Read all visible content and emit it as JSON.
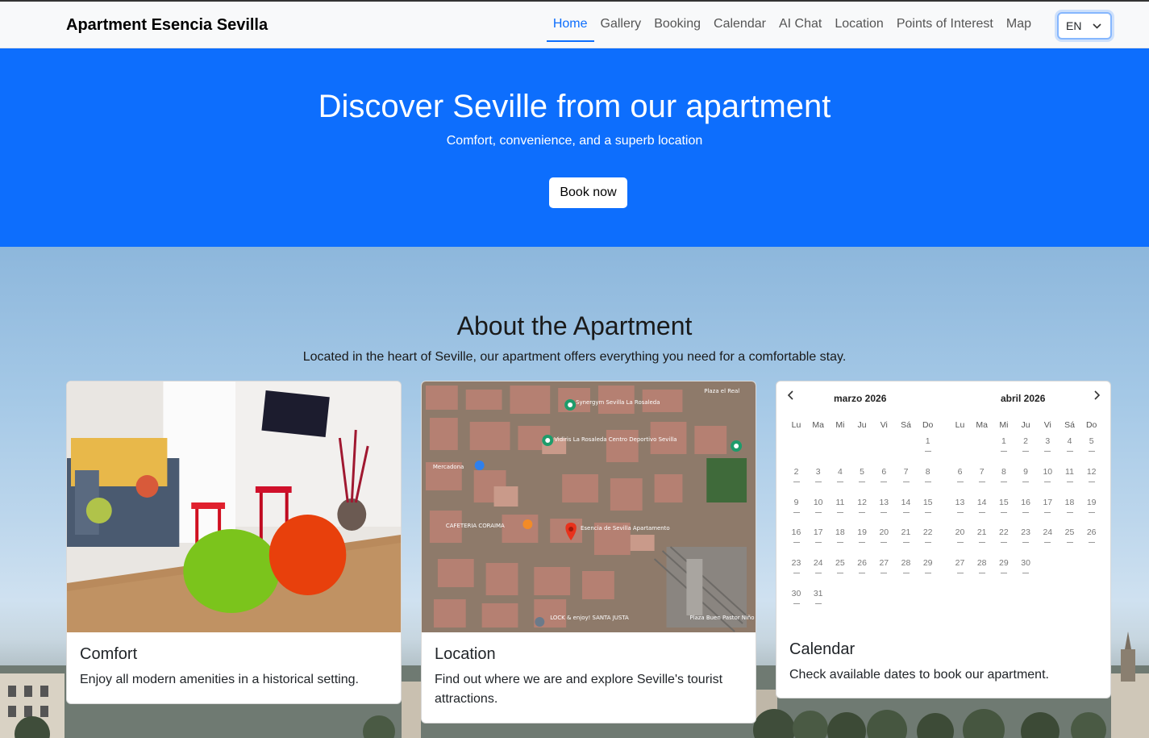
{
  "brand": "Apartment Esencia Sevilla",
  "nav": {
    "links": [
      "Home",
      "Gallery",
      "Booking",
      "Calendar",
      "AI Chat",
      "Location",
      "Points of Interest",
      "Map"
    ],
    "active": "Home",
    "language": "EN"
  },
  "hero": {
    "title": "Discover Seville from our apartment",
    "subtitle": "Comfort, convenience, and a superb location",
    "button": "Book now",
    "color": "#0d6efd"
  },
  "about": {
    "title": "About the Apartment",
    "lead": "Located in the heart of Seville, our apartment offers everything you need for a comfortable stay."
  },
  "cards": {
    "comfort": {
      "title": "Comfort",
      "text": "Enjoy all modern amenities in a historical setting."
    },
    "location": {
      "title": "Location",
      "text": "Find out where we are and explore Seville's tourist attractions."
    },
    "calendar": {
      "title": "Calendar",
      "text": "Check available dates to book our apartment."
    }
  },
  "map_labels": {
    "gym": "Synergym Sevilla La Rosaleda",
    "sports": "Vidiris La Rosaleda Centro Deportivo Sevilla",
    "mercadona": "Mercadona",
    "cafeteria": "CAFETERIA CORAIMA",
    "apartment": "Esencia de Sevilla Apartamento",
    "lock": "LOCK & enjoy! SANTA JUSTA",
    "plaza": "Plaza Buen Pastor Niño",
    "plaza_real": "Plaza el Real"
  },
  "calendar": {
    "dow": [
      "Lu",
      "Ma",
      "Mi",
      "Ju",
      "Vi",
      "Sá",
      "Do"
    ],
    "months": [
      {
        "label": "marzo 2026",
        "offset": 6,
        "days": 31
      },
      {
        "label": "abril 2026",
        "offset": 2,
        "days": 30
      }
    ]
  }
}
